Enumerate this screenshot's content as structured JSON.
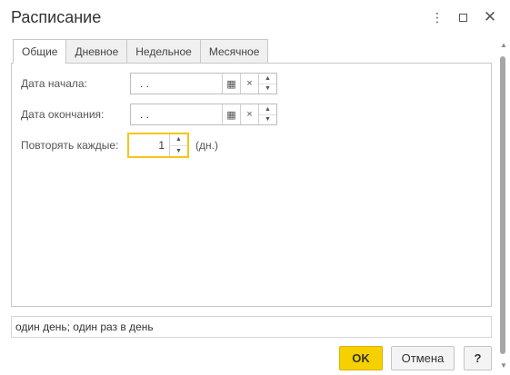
{
  "window": {
    "title": "Расписание",
    "more_glyph": "⋮",
    "close_glyph": "✕"
  },
  "tabs": [
    {
      "label": "Общие",
      "active": true
    },
    {
      "label": "Дневное",
      "active": false
    },
    {
      "label": "Недельное",
      "active": false
    },
    {
      "label": "Месячное",
      "active": false
    }
  ],
  "form": {
    "start_date": {
      "label": "Дата начала:",
      "value": ". ."
    },
    "end_date": {
      "label": "Дата окончания:",
      "value": ". ."
    },
    "repeat": {
      "label": "Повторять каждые:",
      "value": "1",
      "unit": "(дн.)"
    },
    "calendar_glyph": "▦",
    "clear_glyph": "×",
    "spin_up_glyph": "▲",
    "spin_down_glyph": "▼"
  },
  "summary": "один день; один раз в день",
  "buttons": {
    "ok": "OK",
    "cancel": "Отмена",
    "help": "?"
  },
  "colors": {
    "accent_yellow": "#f6d000",
    "focus_border": "#f5c518"
  }
}
